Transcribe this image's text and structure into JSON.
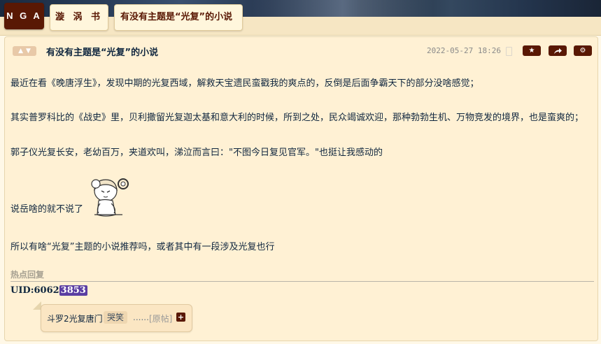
{
  "nav": {
    "logo_text": "N G A",
    "forum": "漩 涡 书 院",
    "topic": "有没有主题是“光复”的小说"
  },
  "post": {
    "vote_icons": [
      "thumbs-up-icon",
      "thumbs-down-icon"
    ],
    "title": "有没有主题是“光复”的小说",
    "date": "2022-05-27 18:26",
    "actions": [
      "star-icon",
      "share-icon",
      "gear-icon"
    ],
    "paragraphs": [
      "最近在看《晚唐浮生》，发现中期的光复西域，解救天宝遗民蛮戳我的爽点的，反倒是后面争霸天下的部分没啥感觉；",
      "其实普罗科比的《战史》里，贝利撒留光复迦太基和意大利的时候，所到之处，民众竭诚欢迎，那种勃勃生机、万物竞发的境界，也是蛮爽的；",
      "郭子仪光复长安，老幼百万，夹道欢叫，涕泣而言曰：\"不图今日复见官军。\"也挺让我感动的",
      "说岳啥的就不说了",
      "所以有啥“光复”主题的小说推荐吗，或者其中有一段涉及光复也行"
    ],
    "sticker_icon": "anime-sticker-icon"
  },
  "hot_reply": {
    "label": "热点回复",
    "uid_prefix": "UID:6062",
    "uid_highlight": "3853",
    "reply_text": "斗罗2光复唐门",
    "emoticon": "哭笑",
    "ellipsis": "......",
    "original_link": "[原帖]",
    "plus": "+"
  },
  "colors": {
    "accent": "#591804",
    "page_bg": "#fff8e7",
    "text": "#10273f",
    "uid_highlight": "#5a3ea2"
  }
}
